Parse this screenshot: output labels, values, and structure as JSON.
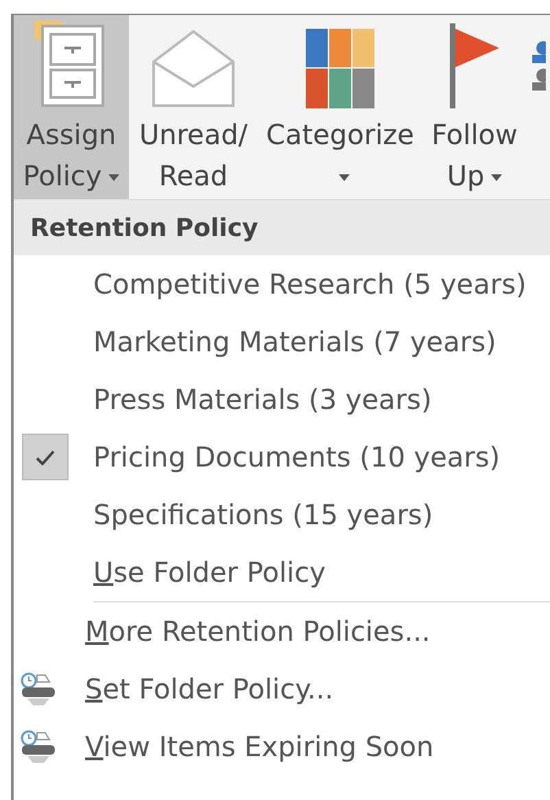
{
  "ribbon": {
    "buttons": [
      {
        "kind": "policy",
        "lines": [
          "Assign",
          "Policy"
        ],
        "dropdown": true,
        "selected": true
      },
      {
        "kind": "envelope",
        "lines": [
          "Unread/",
          "Read"
        ],
        "dropdown": false,
        "selected": false
      },
      {
        "kind": "categories",
        "lines": [
          "Categorize"
        ],
        "dropdown": true,
        "selected": false
      },
      {
        "kind": "flag",
        "lines": [
          "Follow",
          "Up"
        ],
        "dropdown": true,
        "selected": false
      }
    ]
  },
  "menu": {
    "header": "Retention Policy",
    "policies": [
      {
        "label": "Competitive Research (5 years)",
        "checked": false,
        "underline_first": false
      },
      {
        "label": "Marketing Materials (7 years)",
        "checked": false,
        "underline_first": false
      },
      {
        "label": "Press Materials (3 years)",
        "checked": false,
        "underline_first": false
      },
      {
        "label": "Pricing Documents (10 years)",
        "checked": true,
        "underline_first": false
      },
      {
        "label": "Specifications (15 years)",
        "checked": false,
        "underline_first": false
      },
      {
        "label": "Use Folder Policy",
        "checked": false,
        "underline_first": true
      }
    ],
    "commands": [
      {
        "label": "More Retention Policies...",
        "icon": false,
        "underline_first": true
      },
      {
        "label": "Set Folder Policy...",
        "icon": true,
        "underline_first": true
      },
      {
        "label": "View Items Expiring Soon",
        "icon": true,
        "underline_first": true
      }
    ]
  }
}
